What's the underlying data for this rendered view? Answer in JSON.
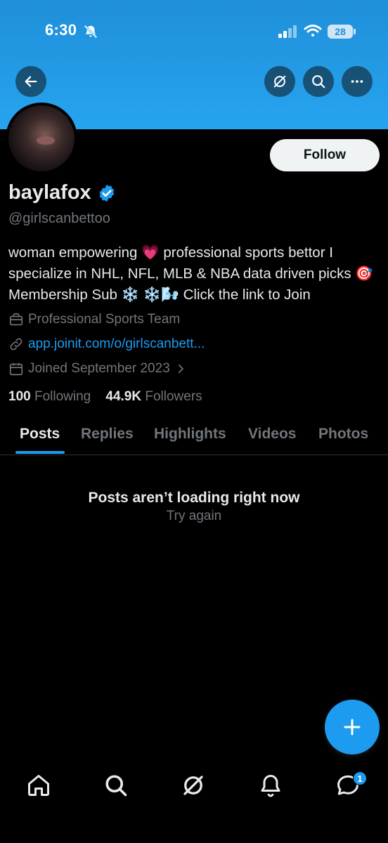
{
  "status_bar": {
    "time": "6:30",
    "battery": "28",
    "icons": [
      "bell-muted-icon",
      "signal-icon",
      "wifi-icon",
      "battery-icon"
    ]
  },
  "top_bar": {
    "icons": [
      "back-arrow-icon",
      "grok-icon",
      "search-icon",
      "more-icon"
    ]
  },
  "profile": {
    "follow_label": "Follow",
    "name": "baylafox",
    "handle": "@girlscanbettoo",
    "bio": "woman empowering 💗 professional sports bettor I specialize in NHL, NFL, MLB & NBA data driven picks 🎯 Membership Sub ❄️ ❄️🌬️ Click the link to Join",
    "category": "Professional Sports Team",
    "link": "app.joinit.com/o/girlscanbett...",
    "joined": "Joined September 2023",
    "following_count": "100",
    "following_label": "Following",
    "followers_count": "44.9K",
    "followers_label": "Followers"
  },
  "tabs": [
    "Posts",
    "Replies",
    "Highlights",
    "Videos",
    "Photos"
  ],
  "active_tab": "Posts",
  "error": {
    "title": "Posts aren’t loading right now",
    "retry": "Try again"
  },
  "bottom_nav": {
    "icons": [
      "home-icon",
      "search-icon",
      "grok-icon",
      "notifications-icon",
      "messages-icon"
    ],
    "messages_badge": "1"
  },
  "colors": {
    "banner": "#27a4ef",
    "accent": "#1d9bf0",
    "background": "#000000",
    "text": "#e7e9ea",
    "secondary": "#71767b"
  }
}
